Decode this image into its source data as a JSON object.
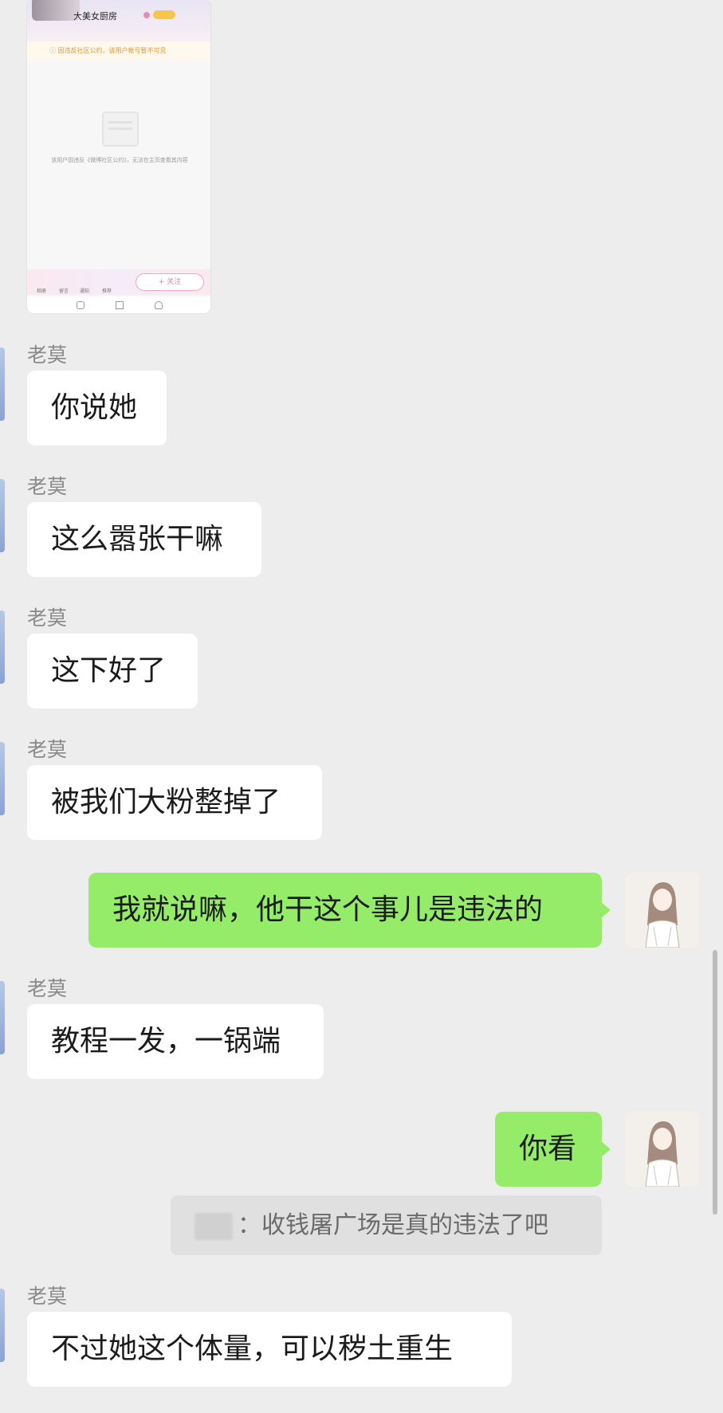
{
  "shared_image": {
    "profile_name": "大美女厨房",
    "warning_text": "ⓘ 因违反社区公约，该用户帐号暂不可见",
    "empty_note": "该用户因违反《微博社区公约》，无法在主页查看其内容",
    "tabs": [
      "相册",
      "留言",
      "通知",
      "推荐"
    ],
    "follow_label": "+ 关注"
  },
  "chat": {
    "sender_name": "老莫",
    "messages": [
      {
        "side": "in",
        "text": "你说她"
      },
      {
        "side": "in",
        "text": "这么嚣张干嘛"
      },
      {
        "side": "in",
        "text": "这下好了"
      },
      {
        "side": "in",
        "text": "被我们大粉整掉了"
      },
      {
        "side": "out",
        "text": "我就说嘛，他干这个事儿是违法的"
      },
      {
        "side": "in",
        "text": "教程一发，一锅端"
      },
      {
        "side": "out",
        "text": "你看"
      },
      {
        "side": "in",
        "text": "不过她这个体量，可以秽土重生"
      }
    ],
    "quote": {
      "text": "：收钱屠广场是真的违法了吧"
    }
  },
  "colors": {
    "background": "#ededed",
    "incoming_bubble": "#ffffff",
    "outgoing_bubble": "#95ec69",
    "sender_text": "#8a8a8a"
  }
}
